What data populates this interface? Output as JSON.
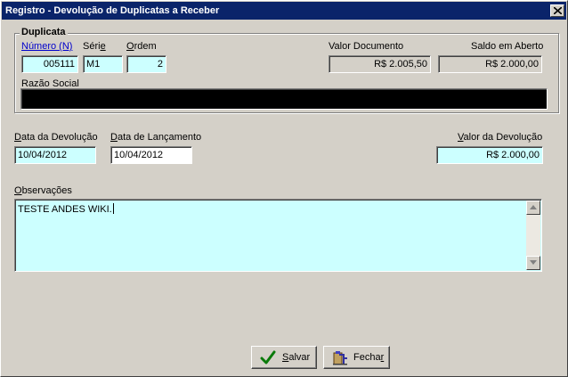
{
  "window": {
    "title": "Registro - Devolução de Duplicatas a Receber",
    "close_icon": "close-icon"
  },
  "duplicata": {
    "group_label": "Duplicata",
    "numero_label": "Número (N)",
    "numero_value": "005111",
    "serie_label_pre": "Séri",
    "serie_label_u": "e",
    "serie_value": "M1",
    "ordem_label_u": "O",
    "ordem_label_post": "rdem",
    "ordem_value": "2",
    "valor_documento_label": "Valor Documento",
    "valor_documento_value": "R$ 2.005,50",
    "saldo_label": "Saldo em Aberto",
    "saldo_value": "R$ 2.000,00",
    "razao_label": "Razão Social",
    "razao_value": ""
  },
  "devolucao": {
    "data_devolucao_label_u": "D",
    "data_devolucao_label_post": "ata da Devolução",
    "data_devolucao_value": "10/04/2012",
    "data_lancamento_label_u": "D",
    "data_lancamento_label_post": "ata de Lançamento",
    "data_lancamento_value": "10/04/2012",
    "valor_label_u": "V",
    "valor_label_post": "alor da Devolução",
    "valor_value": "R$ 2.000,00"
  },
  "observacoes": {
    "label_u": "O",
    "label_post": "bservações",
    "text": "TESTE ANDES WIKI."
  },
  "buttons": {
    "salvar_u": "S",
    "salvar_post": "alvar",
    "salvar_icon": "checkmark-icon",
    "fechar_pre": "Fecha",
    "fechar_u": "r",
    "fechar_icon": "exit-door-icon"
  },
  "colors": {
    "titlebar": "#0a246a",
    "face": "#d4d0c8",
    "input_highlight": "#ccffff"
  }
}
